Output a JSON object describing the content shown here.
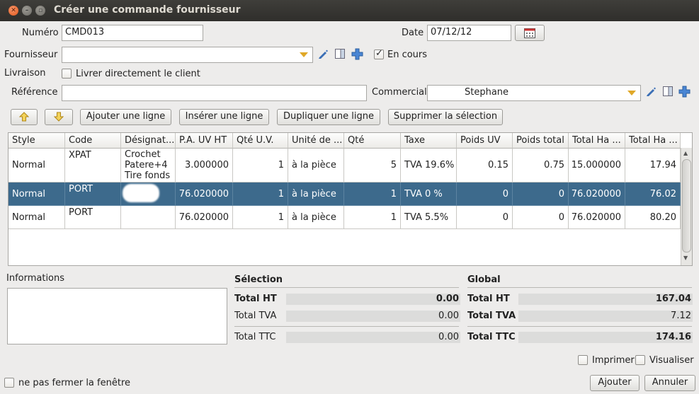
{
  "window": {
    "title": "Créer une commande fournisseur"
  },
  "form": {
    "numero_label": "Numéro",
    "numero_value": "CMD013",
    "date_label": "Date",
    "date_value": "07/12/12",
    "fournisseur_label": "Fournisseur",
    "fournisseur_value": "",
    "en_cours_label": "En cours",
    "livraison_label": "Livraison",
    "livrer_label": "Livrer directement le client",
    "reference_label": "Référence",
    "reference_value": "",
    "commercial_label": "Commercial",
    "commercial_value": "Stephane"
  },
  "toolbar": {
    "add": "Ajouter une ligne",
    "insert": "Insérer une ligne",
    "duplicate": "Dupliquer une ligne",
    "delete": "Supprimer la sélection"
  },
  "table": {
    "columns": [
      "Style",
      "Code",
      "Désignat...",
      "P.A. UV HT",
      "Qté U.V.",
      "Unité de ...",
      "Qté",
      "Taxe",
      "Poids UV",
      "Poids total",
      "Total Ha ...",
      "Total Ha ..."
    ],
    "rows": [
      {
        "style": "Normal",
        "code": "XPAT",
        "designation": [
          "Crochet",
          "Patere+4",
          "Tire fonds"
        ],
        "pa": "3.000000",
        "qte_uv": "1",
        "unite": "à la pièce",
        "qte": "5",
        "taxe": "TVA 19.6%",
        "poids_uv": "0.15",
        "poids_total": "0.75",
        "total_ha": "15.000000",
        "total_ha2": "17.94"
      },
      {
        "style": "Normal",
        "code": "PORT",
        "designation": [
          ""
        ],
        "pa": "76.020000",
        "qte_uv": "1",
        "unite": "à la pièce",
        "qte": "1",
        "taxe": "TVA 0 %",
        "poids_uv": "0",
        "poids_total": "0",
        "total_ha": "76.020000",
        "total_ha2": "76.02"
      },
      {
        "style": "Normal",
        "code": "PORT",
        "designation": [
          ""
        ],
        "pa": "76.020000",
        "qte_uv": "1",
        "unite": "à la pièce",
        "qte": "1",
        "taxe": "TVA 5.5%",
        "poids_uv": "0",
        "poids_total": "0",
        "total_ha": "76.020000",
        "total_ha2": "80.20"
      }
    ]
  },
  "informations": {
    "label": "Informations",
    "value": ""
  },
  "selection": {
    "title": "Sélection",
    "total_ht_label": "Total HT",
    "total_ht": "0.00",
    "total_tva_label": "Total TVA",
    "total_tva": "0.00",
    "total_ttc_label": "Total TTC",
    "total_ttc": "0.00"
  },
  "global": {
    "title": "Global",
    "total_ht_label": "Total HT",
    "total_ht": "167.04",
    "total_tva_label": "Total TVA",
    "total_tva": "7.12",
    "total_ttc_label": "Total TTC",
    "total_ttc": "174.16"
  },
  "footer": {
    "imprimer": "Imprimer",
    "visualiser": "Visualiser",
    "ne_pas_fermer": "ne pas fermer la fenêtre",
    "ajouter": "Ajouter",
    "annuler": "Annuler"
  }
}
